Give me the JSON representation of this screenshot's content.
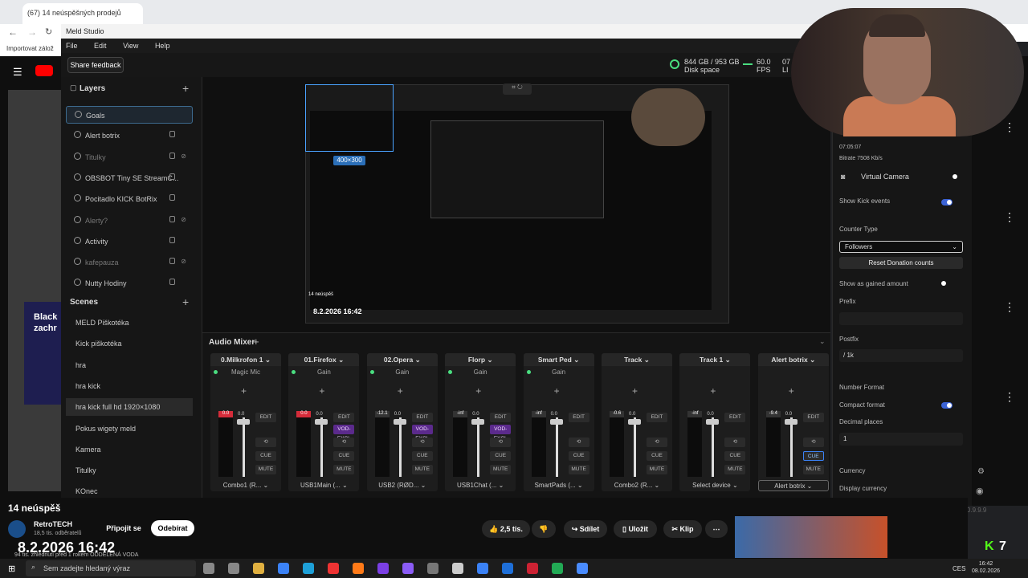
{
  "browser": {
    "tab_title": "(67) 14 neúspěšných prodejů",
    "bookmark": "Importovat zálož"
  },
  "meld": {
    "window_title": "Meld Studio",
    "menu": [
      "File",
      "Edit",
      "View",
      "Help"
    ],
    "share_feedback": "Share feedback",
    "disk_value": "844 GB / 953 GB",
    "disk_label": "Disk space",
    "fps_value": "60.0",
    "fps_label": "FPS",
    "live_value": "07",
    "live_label": "LI"
  },
  "layers": {
    "title": "Layers",
    "items": [
      {
        "label": "Goals",
        "state": "selected"
      },
      {
        "label": "Alert botrix",
        "state": "normal"
      },
      {
        "label": "Titulky",
        "state": "dim"
      },
      {
        "label": "OBSBOT Tiny SE StreamC...",
        "state": "normal"
      },
      {
        "label": "Pocitadlo KICK BotRix",
        "state": "normal"
      },
      {
        "label": "Alerty?",
        "state": "dim"
      },
      {
        "label": "Activity",
        "state": "normal"
      },
      {
        "label": "kafepauza",
        "state": "dim"
      },
      {
        "label": "Nutty Hodiny",
        "state": "normal"
      }
    ]
  },
  "scenes": {
    "title": "Scenes",
    "items": [
      {
        "label": "MELD Piškotéka"
      },
      {
        "label": "Kick piškotéka"
      },
      {
        "label": "hra"
      },
      {
        "label": "hra kick"
      },
      {
        "label": "hra kick full hd 1920×1080"
      },
      {
        "label": "Pokus wigety meld"
      },
      {
        "label": "Kamera"
      },
      {
        "label": "Titulky"
      },
      {
        "label": "KOnec"
      }
    ]
  },
  "preview": {
    "size_badge": "400×300",
    "date": "8.2.2026 16:42",
    "count": "14 neúspěš"
  },
  "mixer": {
    "title": "Audio Mixer",
    "channels": [
      {
        "name": "0.Milkrofon 1",
        "filter": "Magic Mic",
        "peak": "0.0",
        "val": "0.0",
        "device": "Combo1 (R...",
        "purple": false
      },
      {
        "name": "01.Firefox",
        "filter": "Gain",
        "peak": "0.0",
        "val": "0.0",
        "device": "USB1Main (...",
        "purple": true
      },
      {
        "name": "02.Opera",
        "filter": "Gain",
        "peak": "-12.1",
        "val": "0.0",
        "device": "USB2 (RØD...",
        "purple": true
      },
      {
        "name": "Florp",
        "filter": "Gain",
        "peak": "-inf",
        "val": "0.0",
        "device": "USB1Chat (...",
        "purple": true
      },
      {
        "name": "Smart Ped",
        "filter": "Gain",
        "peak": "-inf",
        "val": "0.0",
        "device": "SmartPads (...",
        "purple": false
      },
      {
        "name": "Track",
        "filter": "",
        "peak": "-0.6",
        "val": "0.0",
        "device": "Combo2 (R...",
        "purple": false
      },
      {
        "name": "Track 1",
        "filter": "",
        "peak": "-inf",
        "val": "0.0",
        "device": "Select device",
        "purple": false
      },
      {
        "name": "Alert botrix",
        "filter": "",
        "peak": "-9.4",
        "val": "0.0",
        "device": "Alert botrix",
        "purple": false
      }
    ],
    "btn_edit": "EDIT",
    "btn_vod": "VOD-EXCL",
    "btn_cue": "CUE",
    "btn_mute": "MUTE"
  },
  "props": {
    "timecode": "07:05:07",
    "bitrate": "Bitrate  7508 Kb/s",
    "virtual_camera": "Virtual Camera",
    "show_kick_events": "Show Kick events",
    "counter_type_label": "Counter Type",
    "counter_type_value": "Followers",
    "reset_donation": "Reset Donation counts",
    "show_gained": "Show as gained amount",
    "prefix_label": "Prefix",
    "prefix_value": "",
    "postfix_label": "Postfix",
    "postfix_value": "/ 1k",
    "number_format": "Number Format",
    "compact_format": "Compact format",
    "decimal_places": "Decimal places",
    "decimal_value": "1",
    "currency": "Currency",
    "display_currency": "Display currency",
    "version": "Version 0.9.9.9"
  },
  "youtube": {
    "video_title": "14 neúspěš",
    "side_text": "Black zachr",
    "channel": "RetroTECH",
    "subscribers": "18,5 tis. odběratelů",
    "join": "Připojit se",
    "subscribe": "Odebírat",
    "likes": "2,5 tis.",
    "share": "Sdílet",
    "save": "Uložit",
    "clip": "Klip",
    "overlay_date": "8.2.2026 16:42",
    "views": "94 tis. zhlédnutí  před 1 rokem  ODDĚLENÁ VODA",
    "kick_count": "7"
  },
  "taskbar": {
    "search_placeholder": "Sem zadejte hledaný výraz",
    "lang": "CES",
    "time": "16:42",
    "date": "08.02.2026"
  },
  "colors": {
    "accent_green": "#4ade80",
    "toggle_blue": "#3b63d6",
    "peak_red": "#d42c3a",
    "vod_purple": "#5b2a8c"
  }
}
